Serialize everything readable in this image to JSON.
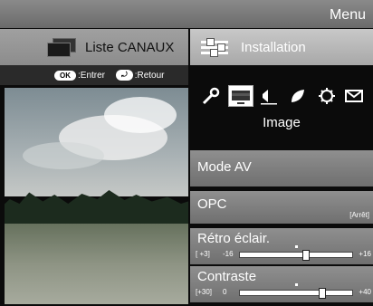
{
  "header": {
    "menu_title": "Menu"
  },
  "tabs": [
    {
      "label": "Liste CANAUX"
    },
    {
      "label": "Installation"
    }
  ],
  "hints": {
    "ok_button": "OK",
    "ok_text": ":Entrer",
    "back_button": "⤾",
    "back_text": ":Retour"
  },
  "icons": [
    "wrench-icon",
    "picture-icon",
    "speaker-icon",
    "leaf-icon",
    "gear-icon",
    "envelope-icon"
  ],
  "submenu": {
    "title": "Image"
  },
  "items": {
    "mode_av": {
      "label": "Mode AV"
    },
    "opc": {
      "label": "OPC",
      "value": "[Arrêt]"
    },
    "retro": {
      "label": "Rétro éclair.",
      "current": "[  +3]",
      "min": "-16",
      "max": "+16",
      "level": 0.594
    },
    "contraste": {
      "label": "Contraste",
      "current": "[+30]",
      "min": "0",
      "max": "+40",
      "level": 0.75
    }
  },
  "colors": {
    "accent_text": "#ffffff",
    "selected_tab": "#b8b8b8"
  }
}
